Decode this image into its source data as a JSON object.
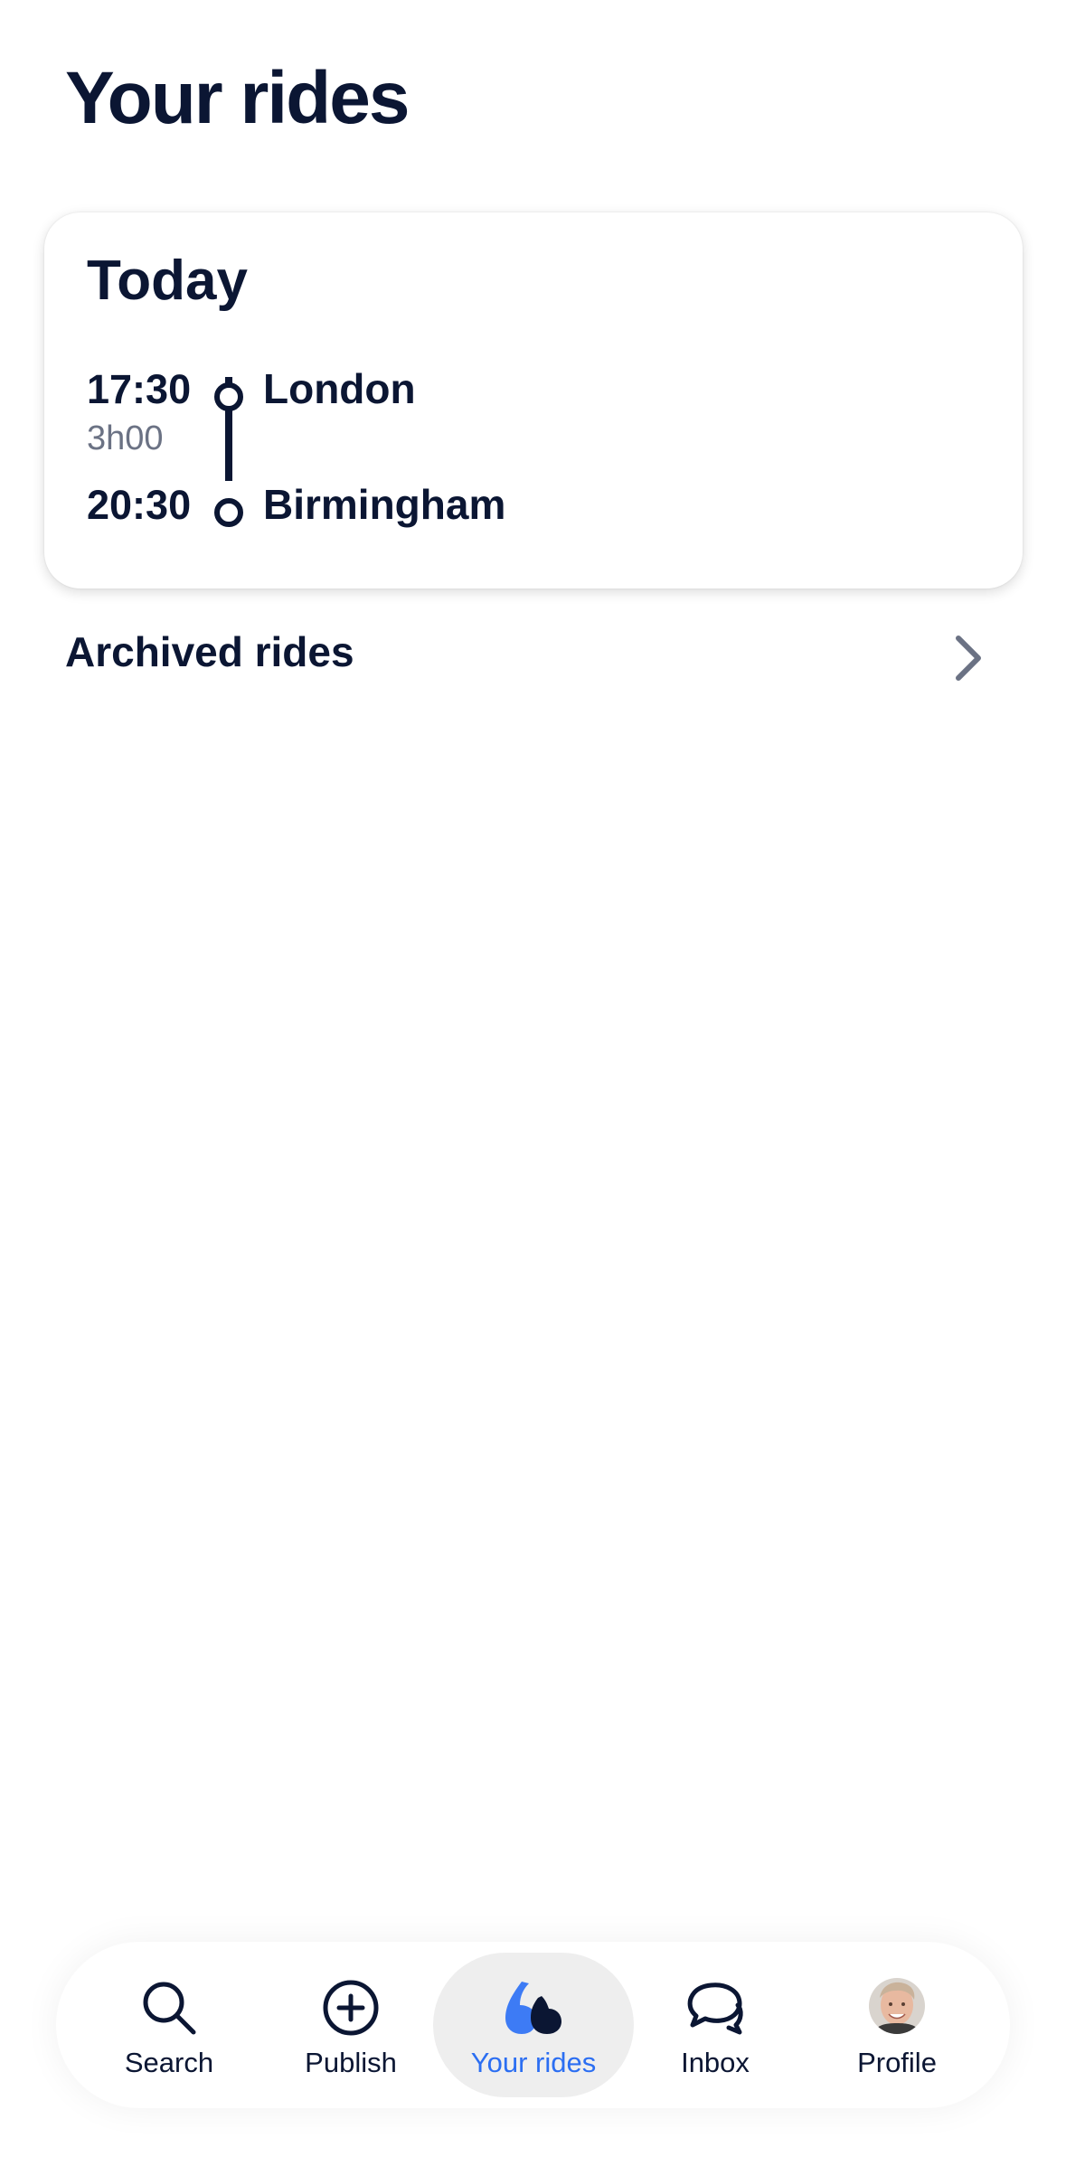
{
  "page": {
    "title": "Your rides"
  },
  "ride_card": {
    "heading": "Today",
    "departure_time": "17:30",
    "duration": "3h00",
    "arrival_time": "20:30",
    "origin": "London",
    "destination": "Birmingham"
  },
  "archived": {
    "label": "Archived rides",
    "icon": "chevron-right-icon"
  },
  "tabbar": {
    "items": [
      {
        "label": "Search",
        "icon": "search-icon"
      },
      {
        "label": "Publish",
        "icon": "plus-circle-icon"
      },
      {
        "label": "Your rides",
        "icon": "rides-icon",
        "active": true
      },
      {
        "label": "Inbox",
        "icon": "chat-bubbles-icon"
      },
      {
        "label": "Profile",
        "icon": "avatar"
      }
    ]
  },
  "colors": {
    "text": "#0b1633",
    "muted": "#6b7284",
    "accent": "#2b6ef2",
    "active_tab_bg": "#eeeeee"
  }
}
